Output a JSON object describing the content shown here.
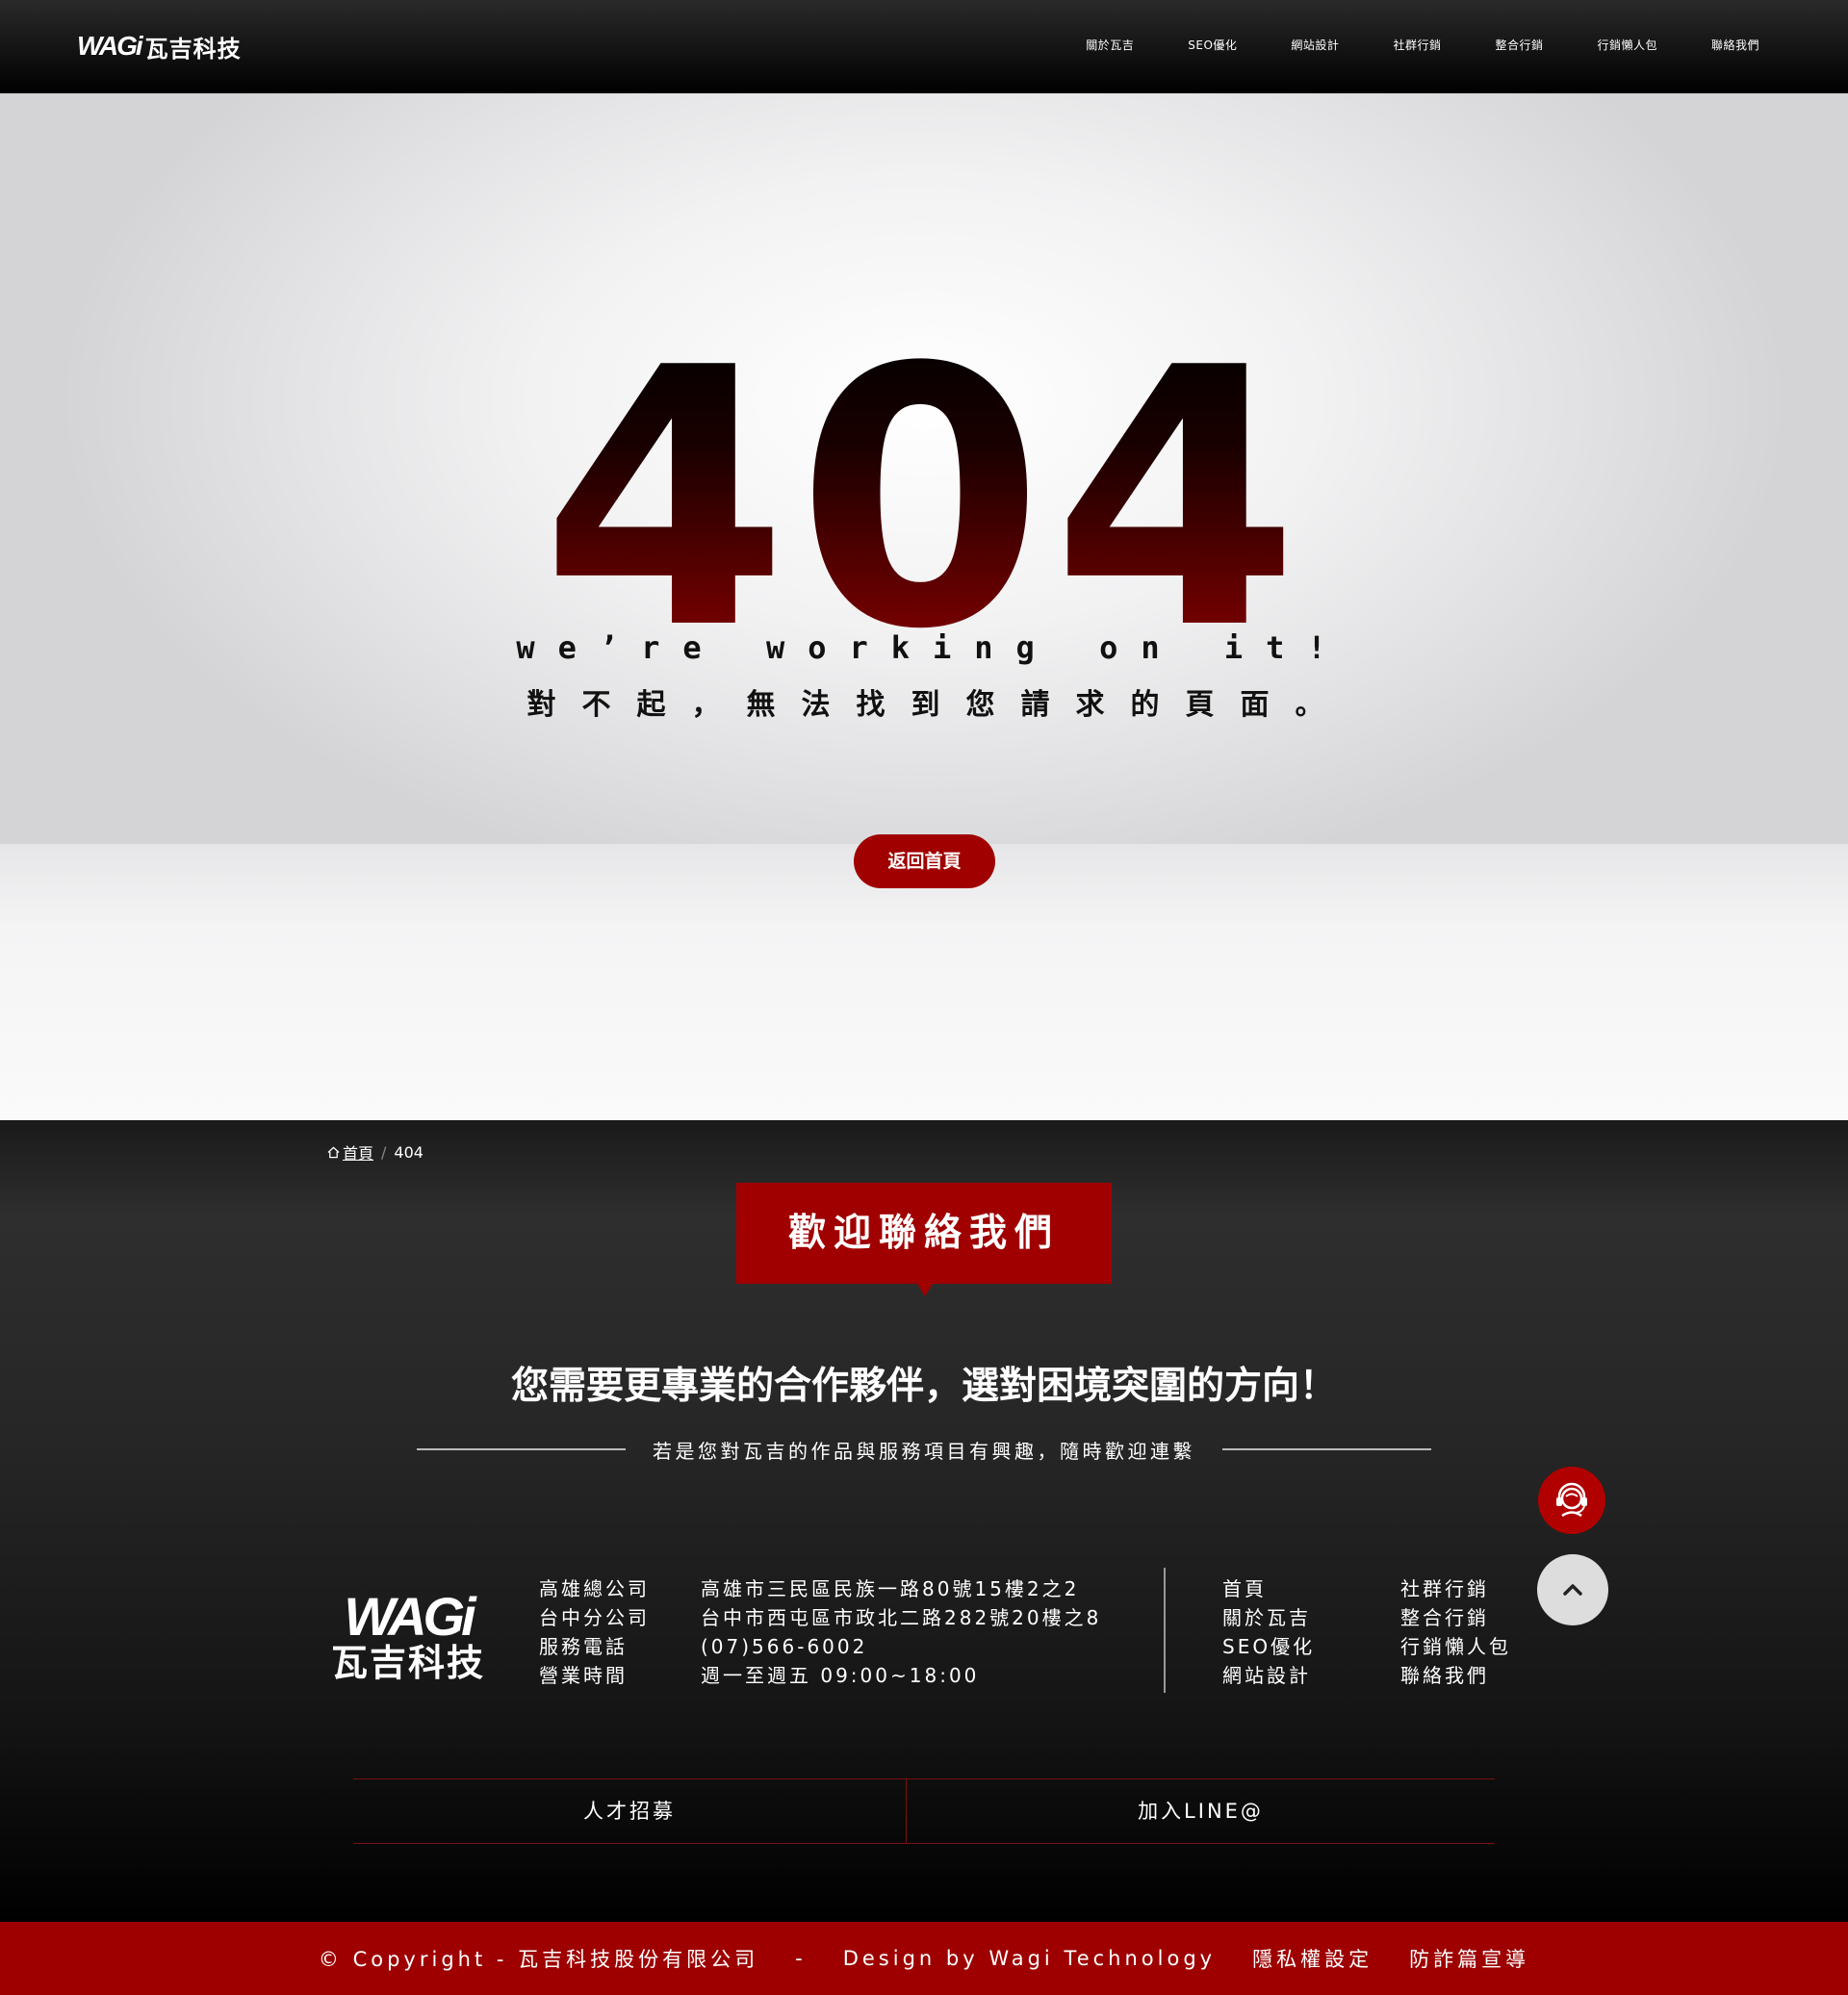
{
  "header": {
    "logo_mark": "WAGi",
    "logo_text": "瓦吉科技",
    "nav": [
      "關於瓦吉",
      "SEO優化",
      "網站設計",
      "社群行銷",
      "整合行銷",
      "行銷懶人包",
      "聯絡我們"
    ]
  },
  "hero": {
    "code": "404",
    "subtitle_en": "we’re working on it!",
    "subtitle_zh": "對不起，無法找到您請求的頁面。",
    "button": "返回首頁"
  },
  "breadcrumb": {
    "home": "首頁",
    "current": "404"
  },
  "footer": {
    "contact_title": "歡迎聯絡我們",
    "headline": "您需要更專業的合作夥伴，選對困境突圍的方向！",
    "tagline": "若是您對瓦吉的作品與服務項目有興趣，隨時歡迎連繫",
    "logo_mark": "WAGi",
    "logo_text": "瓦吉科技",
    "info": [
      {
        "label": "高雄總公司",
        "value": "高雄市三民區民族一路80號15樓2之2"
      },
      {
        "label": "台中分公司",
        "value": "台中市西屯區市政北二路282號20樓之8"
      },
      {
        "label": "服務電話",
        "value": "(07)566-6002"
      },
      {
        "label": "營業時間",
        "value": "週一至週五 09:00~18:00"
      }
    ],
    "links": [
      "首頁",
      "社群行銷",
      "關於瓦吉",
      "整合行銷",
      "SEO優化",
      "行銷懶人包",
      "網站設計",
      "聯絡我們"
    ],
    "bottom_links": [
      "人才招募",
      "加入LINE@"
    ]
  },
  "copyright": {
    "text": "© Copyright - 瓦吉科技股份有限公司",
    "sep": "-",
    "design": "Design by Wagi Technology",
    "privacy": "隱私權設定",
    "fraud": "防詐篇宣導"
  },
  "colors": {
    "accent": "#a00000",
    "header_bg": "#000000"
  }
}
